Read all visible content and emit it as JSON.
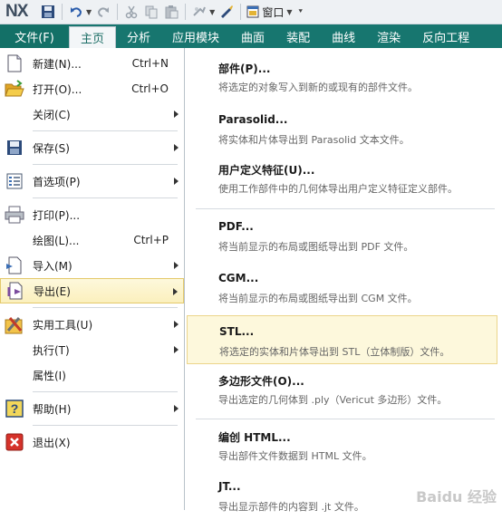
{
  "app": {
    "logo": "NX",
    "window_menu": "窗口"
  },
  "ribbon": {
    "file_tab": "文件(F)",
    "tabs": [
      "主页",
      "分析",
      "应用模块",
      "曲面",
      "装配",
      "曲线",
      "渲染",
      "反向工程"
    ]
  },
  "file_menu": {
    "new": {
      "label": "新建(N)...",
      "shortcut": "Ctrl+N"
    },
    "open": {
      "label": "打开(O)...",
      "shortcut": "Ctrl+O"
    },
    "close": {
      "label": "关闭(C)"
    },
    "save": {
      "label": "保存(S)"
    },
    "preferences": {
      "label": "首选项(P)"
    },
    "print": {
      "label": "打印(P)..."
    },
    "plot": {
      "label": "绘图(L)...",
      "shortcut": "Ctrl+P"
    },
    "import": {
      "label": "导入(M)"
    },
    "export": {
      "label": "导出(E)"
    },
    "utilities": {
      "label": "实用工具(U)"
    },
    "execute": {
      "label": "执行(T)"
    },
    "properties": {
      "label": "属性(I)"
    },
    "help": {
      "label": "帮助(H)"
    },
    "exit": {
      "label": "退出(X)"
    }
  },
  "export_menu": [
    {
      "title": "部件(P)...",
      "desc": "将选定的对象写入到新的或现有的部件文件。"
    },
    {
      "title": "Parasolid...",
      "desc": "将实体和片体导出到 Parasolid 文本文件。"
    },
    {
      "title": "用户定义特征(U)...",
      "desc": "使用工作部件中的几何体导出用户定义特征定义部件。"
    },
    {
      "title": "PDF...",
      "desc": "将当前显示的布局或图纸导出到 PDF 文件。"
    },
    {
      "title": "CGM...",
      "desc": "将当前显示的布局或图纸导出到 CGM 文件。"
    },
    {
      "title": "STL...",
      "desc": "将选定的实体和片体导出到 STL（立体制版）文件。"
    },
    {
      "title": "多边形文件(O)...",
      "desc": "导出选定的几何体到 .ply（Vericut 多边形）文件。"
    },
    {
      "title": "编创 HTML...",
      "desc": "导出部件文件数据到 HTML 文件。"
    },
    {
      "title": "JT...",
      "desc": "导出显示部件的内容到 .jt 文件。"
    }
  ],
  "colors": {
    "ribbon": "#17766f",
    "highlight": "#fbf0bd"
  },
  "watermark": "Baidu 经验"
}
